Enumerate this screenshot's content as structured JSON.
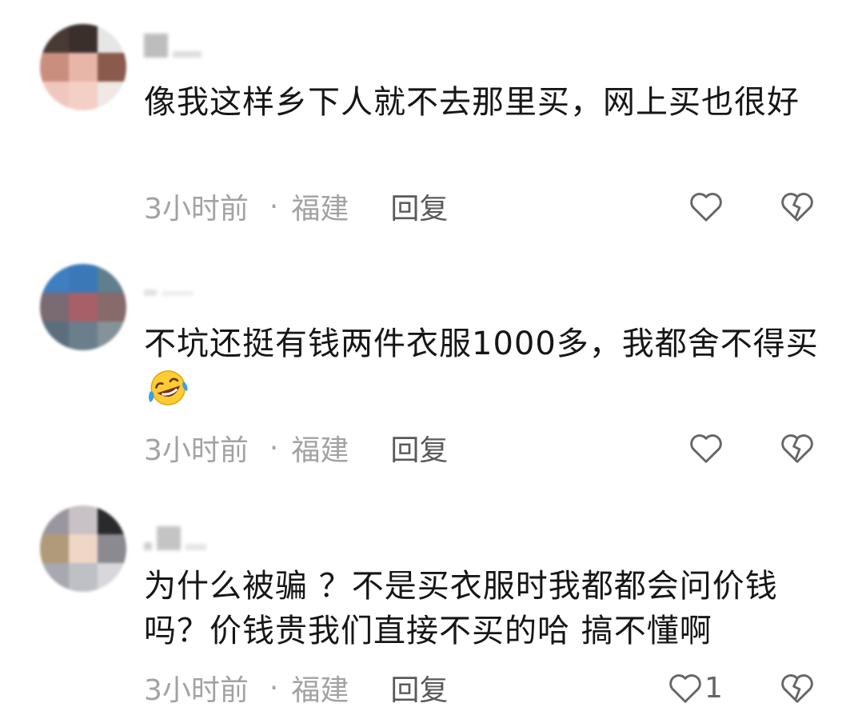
{
  "comments": [
    {
      "text": "像我这样乡下人就不去那里买，网上买也很好",
      "time": "3小时前",
      "separator": "·",
      "location": "福建",
      "reply_label": "回复",
      "like_count": "",
      "emoji": ""
    },
    {
      "text": "不坑还挺有钱两件衣服1000多，我都舍不得买",
      "time": "3小时前",
      "separator": "·",
      "location": "福建",
      "reply_label": "回复",
      "like_count": "",
      "emoji": "rolling-on-floor-laughing-emoji"
    },
    {
      "text": "为什么被骗 ？不是买衣服时我都都会问价钱吗？价钱贵我们直接不买的哈  搞不懂啊",
      "time": "3小时前",
      "separator": "·",
      "location": "福建",
      "reply_label": "回复",
      "like_count": "1",
      "emoji": ""
    }
  ],
  "icons": {
    "like": "heart-outline-icon",
    "dislike": "broken-heart-outline-icon"
  },
  "colors": {
    "text": "#161616",
    "meta": "#a2a2a2",
    "reply": "#5a5a5a",
    "icon": "#666666"
  }
}
